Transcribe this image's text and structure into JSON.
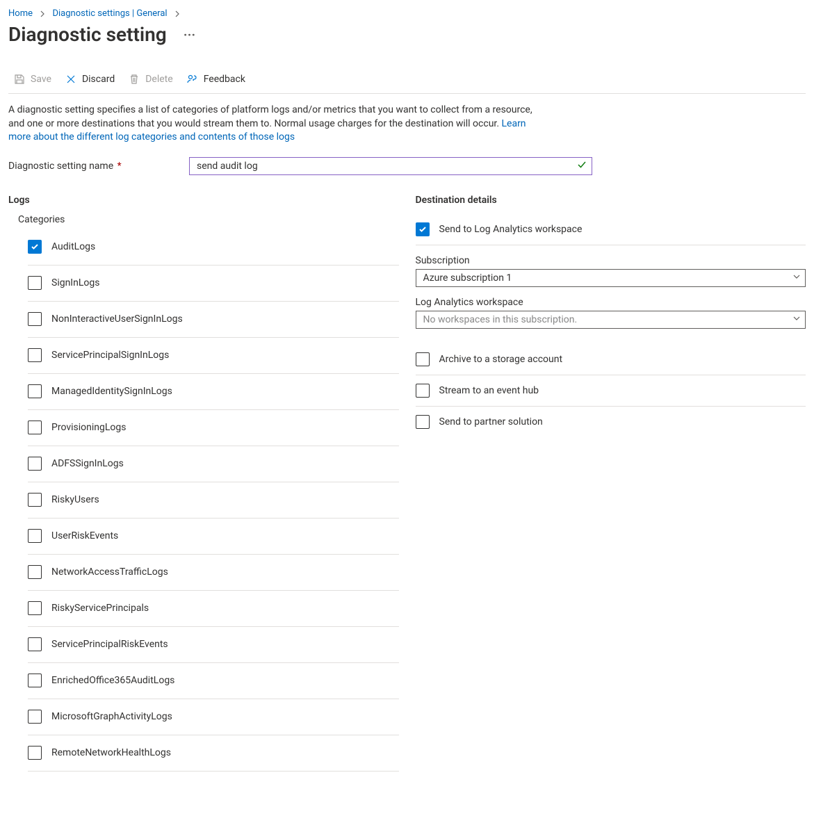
{
  "breadcrumb": {
    "items": [
      {
        "label": "Home"
      },
      {
        "label": "Diagnostic settings | General"
      }
    ]
  },
  "page": {
    "title": "Diagnostic setting"
  },
  "toolbar": {
    "save": "Save",
    "discard": "Discard",
    "delete": "Delete",
    "feedback": "Feedback"
  },
  "intro": {
    "text_a": "A diagnostic setting specifies a list of categories of platform logs and/or metrics that you want to collect from a resource, and one or more destinations that you would stream them to. Normal usage charges for the destination will occur. ",
    "link": "Learn more about the different log categories and contents of those logs"
  },
  "name_field": {
    "label": "Diagnostic setting name",
    "value": "send audit log"
  },
  "logs": {
    "heading": "Logs",
    "subheading": "Categories",
    "items": [
      {
        "label": "AuditLogs",
        "checked": true
      },
      {
        "label": "SignInLogs",
        "checked": false
      },
      {
        "label": "NonInteractiveUserSignInLogs",
        "checked": false
      },
      {
        "label": "ServicePrincipalSignInLogs",
        "checked": false
      },
      {
        "label": "ManagedIdentitySignInLogs",
        "checked": false
      },
      {
        "label": "ProvisioningLogs",
        "checked": false
      },
      {
        "label": "ADFSSignInLogs",
        "checked": false
      },
      {
        "label": "RiskyUsers",
        "checked": false
      },
      {
        "label": "UserRiskEvents",
        "checked": false
      },
      {
        "label": "NetworkAccessTrafficLogs",
        "checked": false
      },
      {
        "label": "RiskyServicePrincipals",
        "checked": false
      },
      {
        "label": "ServicePrincipalRiskEvents",
        "checked": false
      },
      {
        "label": "EnrichedOffice365AuditLogs",
        "checked": false
      },
      {
        "label": "MicrosoftGraphActivityLogs",
        "checked": false
      },
      {
        "label": "RemoteNetworkHealthLogs",
        "checked": false
      }
    ]
  },
  "dest": {
    "heading": "Destination details",
    "options": [
      {
        "label": "Send to Log Analytics workspace",
        "checked": true,
        "expanded": true
      },
      {
        "label": "Archive to a storage account",
        "checked": false
      },
      {
        "label": "Stream to an event hub",
        "checked": false
      },
      {
        "label": "Send to partner solution",
        "checked": false
      }
    ],
    "la": {
      "sub_label": "Subscription",
      "sub_value": "Azure subscription 1",
      "ws_label": "Log Analytics workspace",
      "ws_placeholder": "No workspaces in this subscription."
    }
  }
}
